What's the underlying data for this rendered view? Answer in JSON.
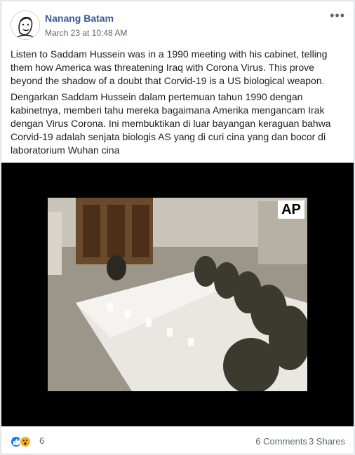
{
  "post": {
    "author": "Nanang Batam",
    "timestamp": "March 23 at 10:48 AM",
    "more_icon": "ellipsis-icon",
    "text_en": "Listen to Saddam Hussein was in a 1990 meeting with his cabinet, telling them how America was threatening Iraq with Corona Virus. This prove beyond the shadow of a doubt that Corvid-19 is a US biological weapon.",
    "text_id": "Dengarkan Saddam Hussein dalam pertemuan tahun 1990 dengan kabinetnya, memberi tahu mereka bagaimana Amerika mengancam Irak dengan Virus Corona. Ini membuktikan di luar bayangan keraguan bahwa Corvid-19 adalah senjata biologis AS yang di curi cina yang dan bocor di laboratorium Wuhan cina",
    "video": {
      "watermark": "AP"
    }
  },
  "footer": {
    "reaction_icons": [
      "like-icon",
      "wow-icon"
    ],
    "reaction_count": "6",
    "comments": "6 Comments",
    "shares": "3 Shares"
  },
  "colors": {
    "author": "#385898",
    "like": "#1877f2",
    "wow": "#f7b125"
  }
}
